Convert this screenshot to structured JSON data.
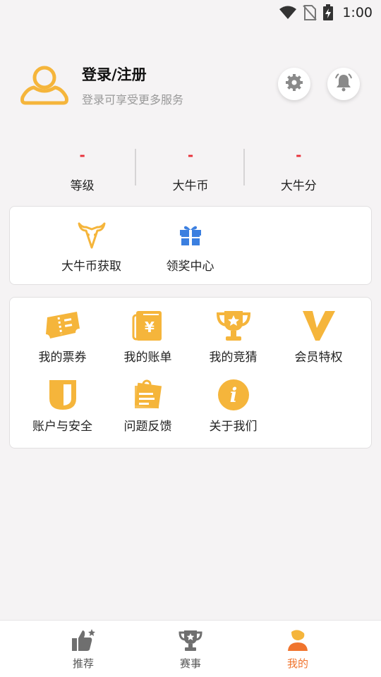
{
  "status_bar": {
    "time": "1:00"
  },
  "profile": {
    "title": "登录/注册",
    "subtitle": "登录可享受更多服务",
    "settings_icon": "gear-icon",
    "notify_icon": "bell-icon"
  },
  "stats": [
    {
      "value": "-",
      "label": "等级"
    },
    {
      "value": "-",
      "label": "大牛币"
    },
    {
      "value": "-",
      "label": "大牛分"
    }
  ],
  "rewards": [
    {
      "label": "大牛币获取",
      "icon": "bull-icon"
    },
    {
      "label": "领奖中心",
      "icon": "gift-icon"
    }
  ],
  "menu": [
    {
      "label": "我的票券",
      "icon": "ticket-icon"
    },
    {
      "label": "我的账单",
      "icon": "bill-icon"
    },
    {
      "label": "我的竞猜",
      "icon": "trophy-icon"
    },
    {
      "label": "会员特权",
      "icon": "vip-icon"
    },
    {
      "label": "账户与安全",
      "icon": "shield-icon"
    },
    {
      "label": "问题反馈",
      "icon": "feedback-icon"
    },
    {
      "label": "关于我们",
      "icon": "info-icon"
    }
  ],
  "bottom_nav": [
    {
      "label": "推荐",
      "icon": "thumbs-up-icon",
      "active": false
    },
    {
      "label": "赛事",
      "icon": "trophy-icon",
      "active": false
    },
    {
      "label": "我的",
      "icon": "user-icon",
      "active": true
    }
  ],
  "colors": {
    "accent_yellow": "#f5b53b",
    "accent_orange": "#f0742d",
    "value_red": "#e8313b",
    "gift_blue": "#3b7fe0"
  }
}
